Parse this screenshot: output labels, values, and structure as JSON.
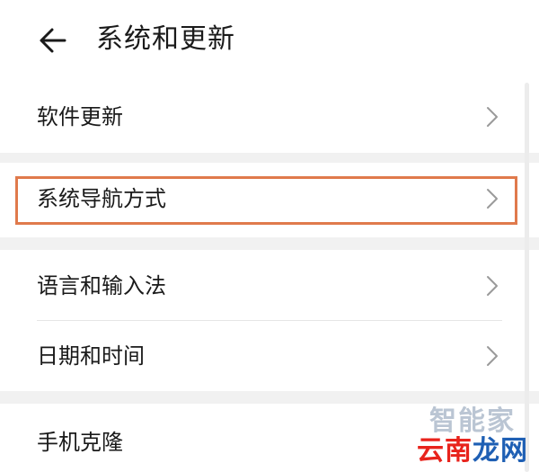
{
  "header": {
    "title": "系统和更新",
    "back_icon": "back-arrow-icon"
  },
  "items": [
    {
      "label": "软件更新",
      "has_chevron": true
    },
    {
      "label": "系统导航方式",
      "has_chevron": true,
      "highlighted": true
    },
    {
      "label": "语言和输入法",
      "has_chevron": true
    },
    {
      "label": "日期和时间",
      "has_chevron": true
    },
    {
      "label": "手机克隆",
      "has_chevron": false
    }
  ],
  "watermark": {
    "top": "智能家",
    "bottom_part1": "云南",
    "bottom_part2": "龙网"
  },
  "colors": {
    "highlight": "#e07a4c",
    "section_gap": "#f1f1f1",
    "watermark_red": "#e8231c",
    "watermark_blue": "#1e5fb4"
  }
}
